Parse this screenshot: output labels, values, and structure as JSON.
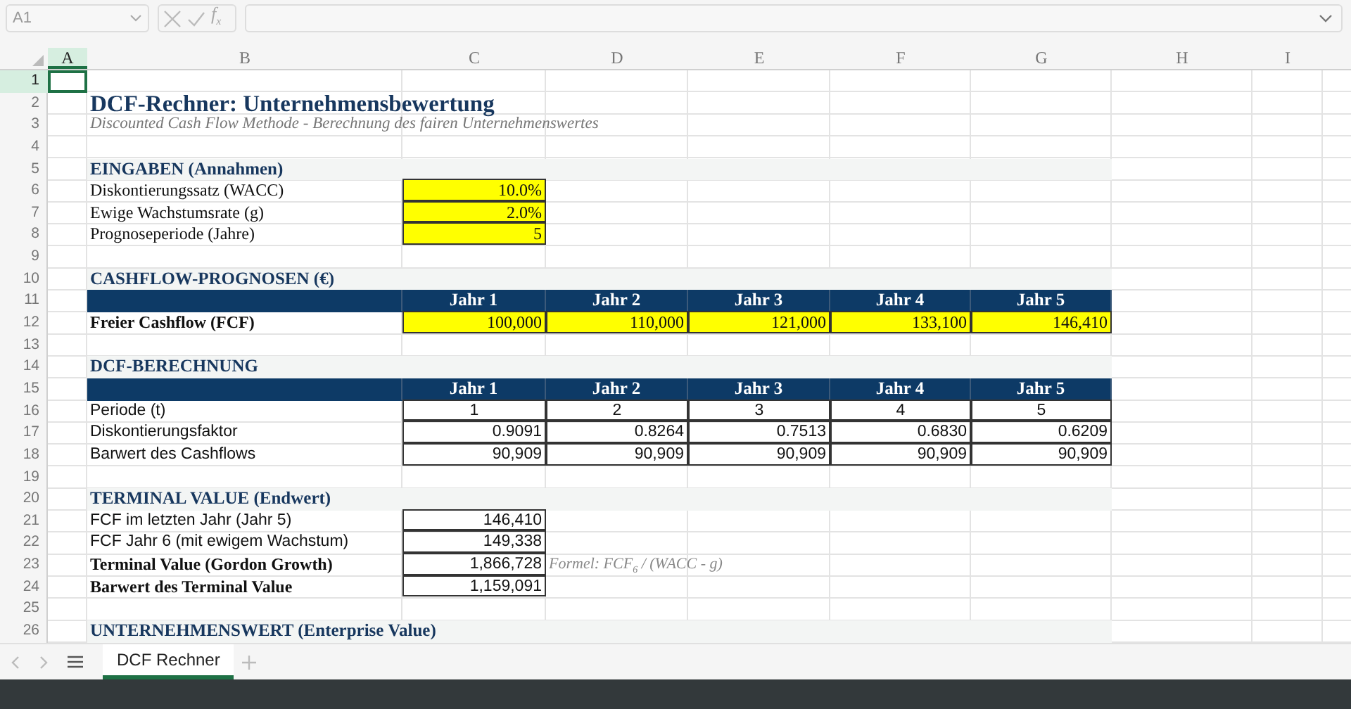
{
  "formula_bar": {
    "name_box": "A1",
    "function_label": "f$_{x}$"
  },
  "columns": [
    {
      "label": "A",
      "selected": true
    },
    {
      "label": "B",
      "selected": false
    },
    {
      "label": "C",
      "selected": false
    },
    {
      "label": "D",
      "selected": false
    },
    {
      "label": "E",
      "selected": false
    },
    {
      "label": "F",
      "selected": false
    },
    {
      "label": "G",
      "selected": false
    },
    {
      "label": "H",
      "selected": false
    },
    {
      "label": "I",
      "selected": false
    }
  ],
  "rows": [
    {
      "number": "1",
      "selected": true,
      "kind": "blank"
    },
    {
      "number": "2",
      "selected": false,
      "kind": "title",
      "text": "DCF-Rechner: Unternehmensbewertung"
    },
    {
      "number": "3",
      "selected": false,
      "kind": "subtitle",
      "text": "Discounted Cash Flow Methode - Berechnung des fairen Unternehmenswertes"
    },
    {
      "number": "4",
      "selected": false,
      "kind": "blank"
    },
    {
      "number": "5",
      "selected": false,
      "kind": "section",
      "text": "EINGABEN (Annahmen)"
    },
    {
      "number": "6",
      "selected": false,
      "kind": "input",
      "label": "Diskontierungssatz (WACC)",
      "value": "10.0%",
      "highlight": true
    },
    {
      "number": "7",
      "selected": false,
      "kind": "input",
      "label": "Ewige Wachstumsrate (g)",
      "value": "2.0%",
      "highlight": true
    },
    {
      "number": "8",
      "selected": false,
      "kind": "input",
      "label": "Prognoseperiode (Jahre)",
      "value": "5",
      "highlight": true
    },
    {
      "number": "9",
      "selected": false,
      "kind": "blank"
    },
    {
      "number": "10",
      "selected": false,
      "kind": "section",
      "text": "CASHFLOW-PROGNOSEN (€)"
    },
    {
      "number": "11",
      "selected": false,
      "kind": "table_header",
      "values": [
        "Jahr 1",
        "Jahr 2",
        "Jahr 3",
        "Jahr 4",
        "Jahr 5"
      ]
    },
    {
      "number": "12",
      "selected": false,
      "kind": "table_row",
      "label": "Freier Cashflow (FCF)",
      "bold": true,
      "highlight": true,
      "values": [
        "100,000",
        "110,000",
        "121,000",
        "133,100",
        "146,410"
      ]
    },
    {
      "number": "13",
      "selected": false,
      "kind": "blank"
    },
    {
      "number": "14",
      "selected": false,
      "kind": "section",
      "text": "DCF-BERECHNUNG"
    },
    {
      "number": "15",
      "selected": false,
      "kind": "table_header",
      "values": [
        "Jahr 1",
        "Jahr 2",
        "Jahr 3",
        "Jahr 4",
        "Jahr 5"
      ]
    },
    {
      "number": "16",
      "selected": false,
      "kind": "period_row",
      "label": "Periode (t)",
      "bold": false,
      "highlight": false,
      "values": [
        "1",
        "2",
        "3",
        "4",
        "5"
      ]
    },
    {
      "number": "17",
      "selected": false,
      "kind": "table_row",
      "label": "Diskontierungsfaktor",
      "bold": false,
      "highlight": false,
      "values": [
        "0.9091",
        "0.8264",
        "0.7513",
        "0.6830",
        "0.6209"
      ]
    },
    {
      "number": "18",
      "selected": false,
      "kind": "table_row",
      "label": "Barwert des Cashflows",
      "bold": false,
      "highlight": false,
      "values": [
        "90,909",
        "90,909",
        "90,909",
        "90,909",
        "90,909"
      ]
    },
    {
      "number": "19",
      "selected": false,
      "kind": "blank"
    },
    {
      "number": "20",
      "selected": false,
      "kind": "section",
      "text": "TERMINAL VALUE (Endwert)"
    },
    {
      "number": "21",
      "selected": false,
      "kind": "boxed",
      "label": "FCF im letzten Jahr (Jahr 5)",
      "value": "146,410",
      "bold": false
    },
    {
      "number": "22",
      "selected": false,
      "kind": "boxed",
      "label": "FCF Jahr 6 (mit ewigem Wachstum)",
      "value": "149,338",
      "bold": false
    },
    {
      "number": "23",
      "selected": false,
      "kind": "boxed",
      "label": "Terminal Value (Gordon Growth)",
      "value": "1,866,728",
      "bold": true,
      "note": "Formel: FCF$_{6}$ / (WACC - g)"
    },
    {
      "number": "24",
      "selected": false,
      "kind": "boxed",
      "label": "Barwert des Terminal Value",
      "value": "1,159,091",
      "bold": true
    },
    {
      "number": "25",
      "selected": false,
      "kind": "blank"
    },
    {
      "number": "26",
      "selected": false,
      "kind": "section",
      "text": "UNTERNEHMENSWERT (Enterprise Value)"
    }
  ],
  "sheet_tabs": [
    {
      "label": "DCF Rechner",
      "selected": true
    }
  ]
}
